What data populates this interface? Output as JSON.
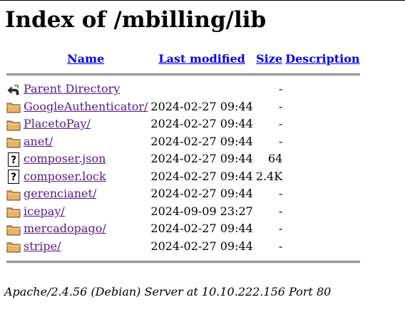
{
  "title": "Index of /mbilling/lib",
  "headers": {
    "name": "Name",
    "last_modified": "Last modified",
    "size": "Size",
    "description": "Description"
  },
  "rows": [
    {
      "icon": "back-icon",
      "name": "Parent Directory",
      "modified": "",
      "size": "-",
      "description": ""
    },
    {
      "icon": "folder-icon",
      "name": "GoogleAuthenticator/",
      "modified": "2024-02-27 09:44",
      "size": "-",
      "description": ""
    },
    {
      "icon": "folder-icon",
      "name": "PlacetoPay/",
      "modified": "2024-02-27 09:44",
      "size": "-",
      "description": ""
    },
    {
      "icon": "folder-icon",
      "name": "anet/",
      "modified": "2024-02-27 09:44",
      "size": "-",
      "description": ""
    },
    {
      "icon": "unknown-file-icon",
      "name": "composer.json",
      "modified": "2024-02-27 09:44",
      "size": "64",
      "description": ""
    },
    {
      "icon": "unknown-file-icon",
      "name": "composer.lock",
      "modified": "2024-02-27 09:44",
      "size": "2.4K",
      "description": ""
    },
    {
      "icon": "folder-icon",
      "name": "gerencianet/",
      "modified": "2024-02-27 09:44",
      "size": "-",
      "description": ""
    },
    {
      "icon": "folder-icon",
      "name": "icepay/",
      "modified": "2024-09-09 23:27",
      "size": "-",
      "description": ""
    },
    {
      "icon": "folder-icon",
      "name": "mercadopago/",
      "modified": "2024-02-27 09:44",
      "size": "-",
      "description": ""
    },
    {
      "icon": "folder-icon",
      "name": "stripe/",
      "modified": "2024-02-27 09:44",
      "size": "-",
      "description": ""
    }
  ],
  "footer": "Apache/2.4.56 (Debian) Server at 10.10.222.156 Port 80"
}
